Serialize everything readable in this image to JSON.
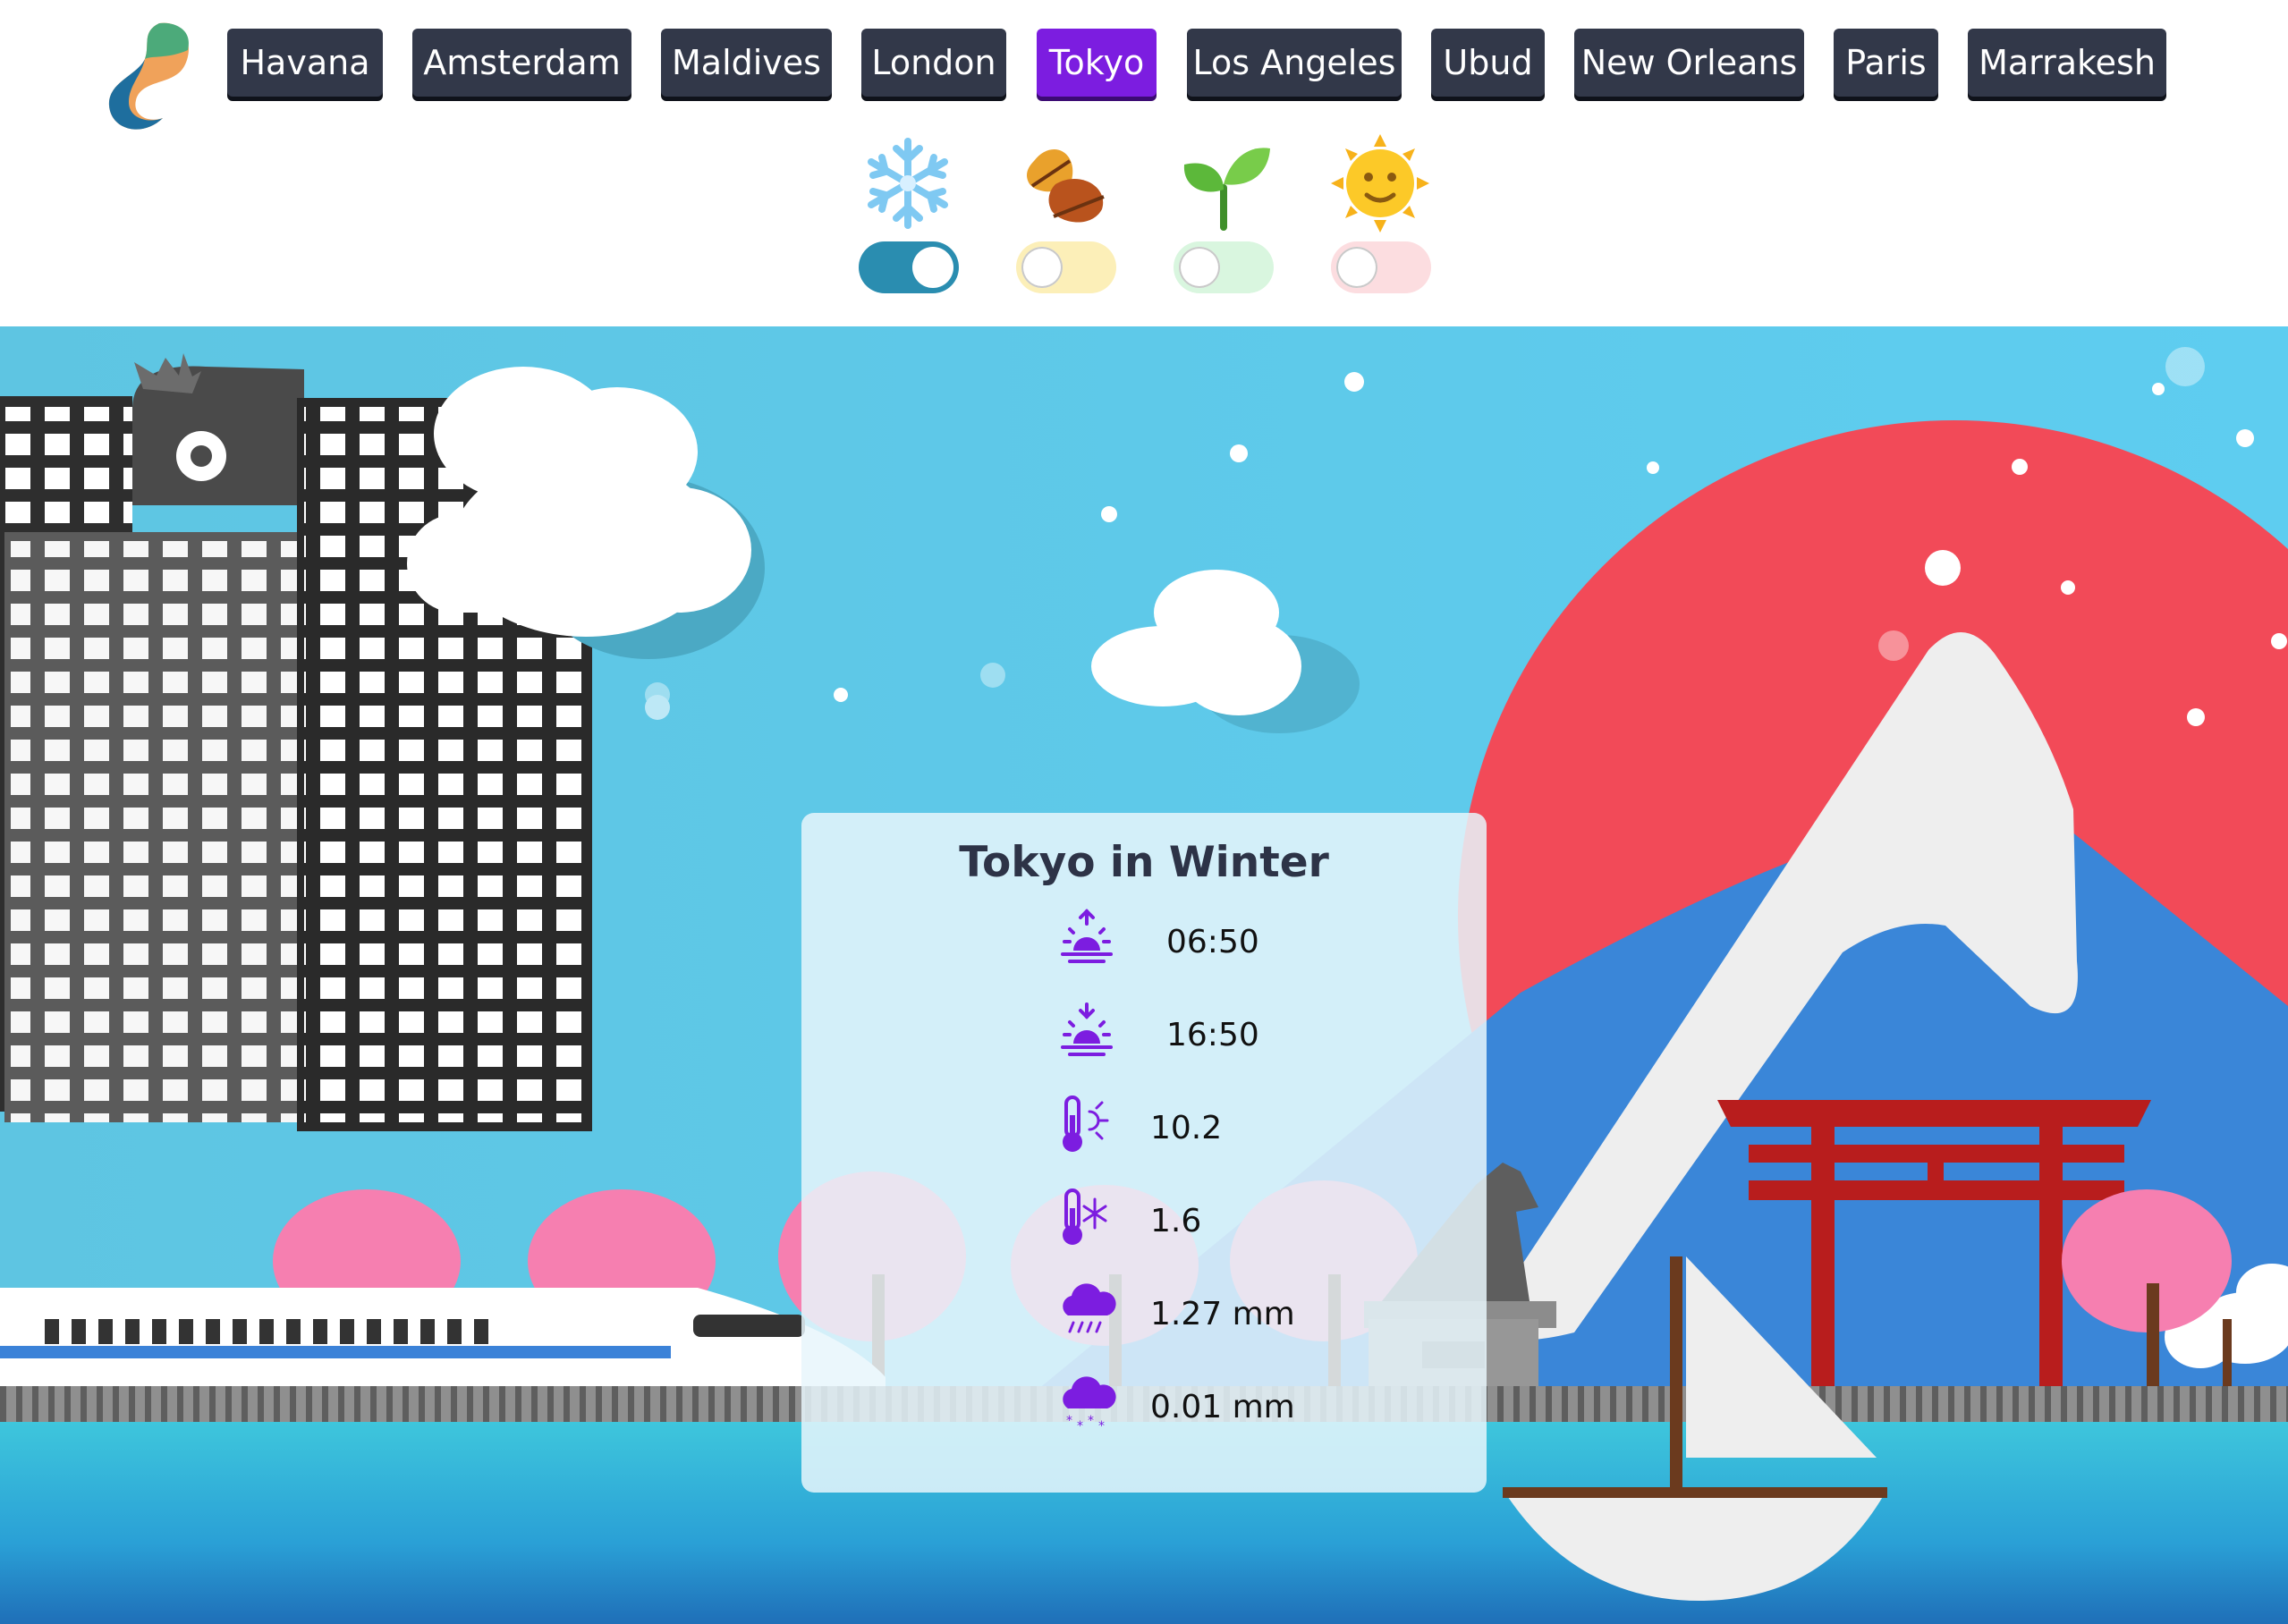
{
  "nav": {
    "cities": [
      "Havana",
      "Amsterdam",
      "Maldives",
      "London",
      "Tokyo",
      "Los Angeles",
      "Ubud",
      "New Orleans",
      "Paris",
      "Marrakesh"
    ],
    "active_city": "Tokyo"
  },
  "seasons": [
    {
      "name": "winter",
      "icon": "snowflake-icon",
      "active": true,
      "track_color": "#2a8db0"
    },
    {
      "name": "autumn",
      "icon": "fallen-leaves-icon",
      "active": false,
      "track_color": "#fcefb8"
    },
    {
      "name": "spring",
      "icon": "seedling-icon",
      "active": false,
      "track_color": "#d9f6df"
    },
    {
      "name": "summer",
      "icon": "sun-face-icon",
      "active": false,
      "track_color": "#fcdde0"
    }
  ],
  "card": {
    "title": "Tokyo in Winter",
    "sunrise": "06:50",
    "sunset": "16:50",
    "temp_high": "10.2",
    "temp_low": "1.6",
    "rain": "1.27 mm",
    "snow": "0.01 mm"
  },
  "colors": {
    "accent_purple": "#7c1de0",
    "button_dark": "#323849",
    "sky": "#5bc8e8",
    "sun_red": "#f24a58",
    "mountain_blue": "#3a86d8",
    "torii_red": "#b81d1d",
    "sakura_pink": "#f67fb0",
    "water": "#2aa5d8"
  }
}
